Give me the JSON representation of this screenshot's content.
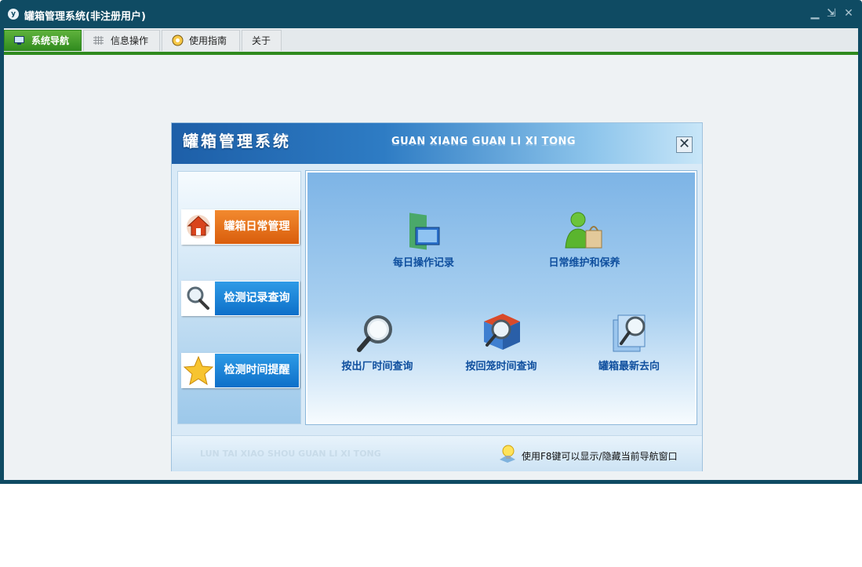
{
  "window": {
    "title": "罐箱管理系统(非注册用户)",
    "logo_text": "y",
    "controls": {
      "minimize": "▁",
      "restore": "⇲",
      "close": "✕"
    }
  },
  "tabs": [
    {
      "label": "系统导航",
      "icon": "monitor-icon",
      "active": true
    },
    {
      "label": "信息操作",
      "icon": "grid-icon",
      "active": false
    },
    {
      "label": "使用指南",
      "icon": "compass-icon",
      "active": false
    },
    {
      "label": "关于",
      "icon": "",
      "active": false
    }
  ],
  "nav": {
    "title": "罐箱管理系统",
    "pinyin_title": "GUAN XIANG GUAN LI XI TONG",
    "close_label": "✕",
    "side_buttons": [
      {
        "label": "罐箱日常管理",
        "icon": "home-icon",
        "style": "orange"
      },
      {
        "label": "检测记录查询",
        "icon": "magnifier-icon",
        "style": "blue"
      },
      {
        "label": "检测时间提醒",
        "icon": "star-icon",
        "style": "blue"
      }
    ],
    "functions": [
      {
        "label": "每日操作记录",
        "icon": "folder-doc-icon"
      },
      {
        "label": "日常维护和保养",
        "icon": "user-bag-icon"
      },
      {
        "label": "按出厂时间查询",
        "icon": "search-icon"
      },
      {
        "label": "按回笼时间查询",
        "icon": "book-search-icon"
      },
      {
        "label": "罐箱最新去向",
        "icon": "doc-search-icon"
      }
    ],
    "footer": {
      "pinyin": "LUN TAI XIAO SHOU GUAN LI XI TONG",
      "tip": "使用F8键可以显示/隐藏当前导航窗口",
      "tip_icon": "lightbulb-icon"
    }
  },
  "colors": {
    "frame": "#0f4b63",
    "active_tab": "#2f8a1e",
    "orange_button": "#e06a14",
    "blue_button": "#1a84d8",
    "function_text": "#0f4f9e"
  }
}
